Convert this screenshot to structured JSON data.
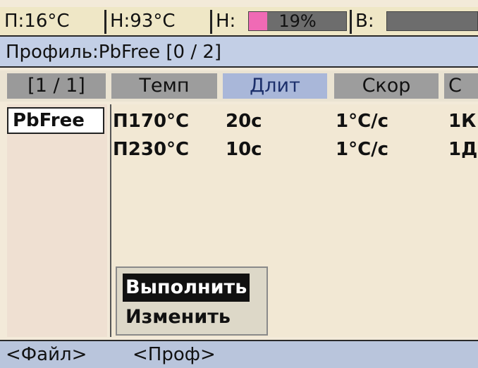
{
  "status": {
    "p_temp": "П:16°C",
    "n_temp": "Н:93°C",
    "n_label": "Н:",
    "n_percent": "19%",
    "n_fill_fraction": 0.19,
    "b_label": "В:",
    "fill_color": "#f06ab5"
  },
  "profile_header": "Профиль:PbFree [0 / 2]",
  "columns": {
    "page": "[1 / 1]",
    "temp": "Темп",
    "duration": "Длит",
    "rate": "Скор",
    "c": "С"
  },
  "profiles": [
    "PbFree"
  ],
  "steps": [
    {
      "temp": "П170°C",
      "duration": "20c",
      "rate": "1°C/c",
      "action": "1К"
    },
    {
      "temp": "П230°C",
      "duration": "10c",
      "rate": "1°C/c",
      "action": "1Д"
    }
  ],
  "menu": {
    "items": [
      "Выполнить",
      "Изменить"
    ],
    "selected_index": 0
  },
  "softkeys": [
    "<Файл>",
    "<Проф>"
  ]
}
